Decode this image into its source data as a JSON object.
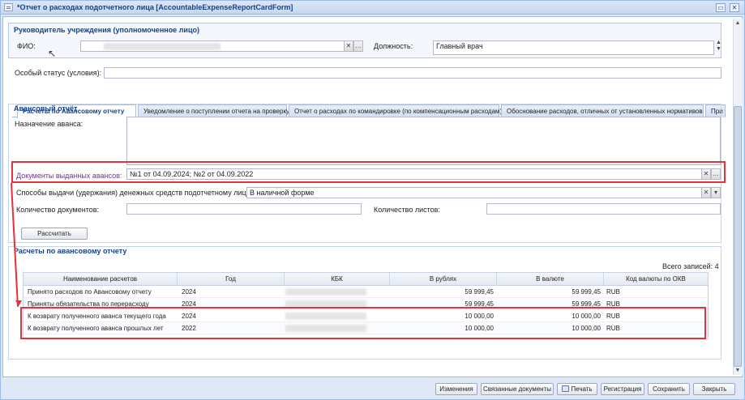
{
  "window": {
    "title": "*Отчет о расходах подотчетного лица [AccountableExpenseReportCardForm]",
    "btn_restore": "▭",
    "btn_close": "✕"
  },
  "head_section": {
    "legend": "Руководитель учреждения (уполномоченное лицо)",
    "fio_label": "ФИО:",
    "fio_value": "",
    "position_label": "Должность:",
    "position_value": "Главный врач",
    "status_label": "Особый статус (условия):",
    "status_value": "",
    "clear_btn": "✕",
    "more_btn": "…"
  },
  "tabs": [
    {
      "label": "Расчеты по Авансовому отчету"
    },
    {
      "label": "Уведомление о поступлении отчета на проверку"
    },
    {
      "label": "Отчет о расходах по командировке (по компенсационным расходам)"
    },
    {
      "label": "Обоснование расходов, отличных от установленных нормативов"
    },
    {
      "label": "При"
    }
  ],
  "advance": {
    "legend": "Авансовый отчёт",
    "purpose_label": "Назначение аванса:",
    "purpose_value": "",
    "docs_label": "Документы выданных авансов:",
    "docs_value": "№1 от 04.09.2024; №2 от 04.09.2022",
    "method_label": "Способы выдачи (удержания) денежных средств подотчетному лицу:",
    "method_value": "В наличной форме",
    "doc_count_label": "Количество документов:",
    "doc_count_value": "",
    "sheet_count_label": "Количество листов:",
    "sheet_count_value": "",
    "calc_button": "Рассчитать"
  },
  "settlements": {
    "legend": "Расчеты по авансовому отчету",
    "total_label": "Всего записей: 4",
    "columns": [
      "Наименование расчетов",
      "Год",
      "КБК",
      "В рублях",
      "В валюте",
      "Код валюты по ОКВ"
    ],
    "rows": [
      {
        "name": "Принято расходов по Авансовому отчету",
        "year": "2024",
        "rub": "59 999,45",
        "cur": "59 999,45",
        "code": "RUB"
      },
      {
        "name": "Приняты обязательства по перерасходу",
        "year": "2024",
        "rub": "59 999,45",
        "cur": "59 999,45",
        "code": "RUB"
      },
      {
        "name": "К возврату полученного аванса текущего года",
        "year": "2024",
        "rub": "10 000,00",
        "cur": "10 000,00",
        "code": "RUB"
      },
      {
        "name": "К возврату полученного аванса прошлых лет",
        "year": "2022",
        "rub": "10 000,00",
        "cur": "10 000,00",
        "code": "RUB"
      }
    ]
  },
  "footer_buttons": {
    "changes": "Изменения",
    "linked": "Связанные документы",
    "print": "Печать",
    "register": "Регистрация",
    "save": "Сохранить",
    "close": "Закрыть"
  },
  "colors": {
    "highlight": "#e0333c",
    "accent": "#15428b",
    "label_purple": "#7a2e94"
  }
}
